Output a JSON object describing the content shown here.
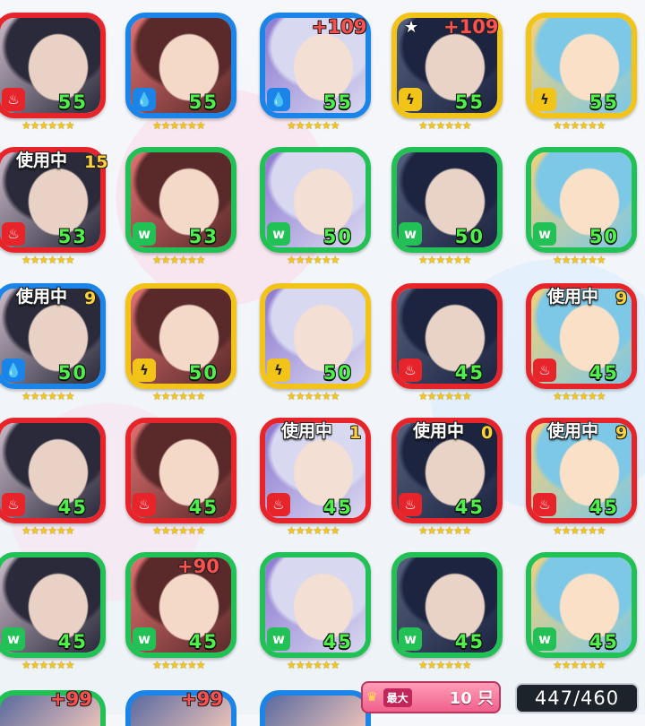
{
  "cards": [
    {
      "attr": "fire",
      "level": "55",
      "plus": "",
      "inuse": "",
      "partial": "",
      "star": false
    },
    {
      "attr": "water",
      "level": "55",
      "plus": "",
      "inuse": "",
      "partial": "",
      "star": false
    },
    {
      "attr": "water",
      "level": "55",
      "plus": "+109",
      "inuse": "",
      "partial": "",
      "star": false
    },
    {
      "attr": "thunder",
      "level": "55",
      "plus": "+109",
      "inuse": "",
      "partial": "",
      "star": true
    },
    {
      "attr": "thunder",
      "level": "55",
      "plus": "",
      "inuse": "",
      "partial": "",
      "star": false
    },
    {
      "attr": "fire",
      "level": "53",
      "plus": "",
      "inuse": "使用中",
      "partial": "15",
      "star": false
    },
    {
      "attr": "wood",
      "level": "53",
      "plus": "",
      "inuse": "",
      "partial": "",
      "star": false
    },
    {
      "attr": "wood",
      "level": "50",
      "plus": "",
      "inuse": "",
      "partial": "",
      "star": false
    },
    {
      "attr": "wood",
      "level": "50",
      "plus": "",
      "inuse": "",
      "partial": "",
      "star": false
    },
    {
      "attr": "wood",
      "level": "50",
      "plus": "",
      "inuse": "",
      "partial": "",
      "star": false
    },
    {
      "attr": "water",
      "level": "50",
      "plus": "",
      "inuse": "使用中",
      "partial": "9",
      "star": false
    },
    {
      "attr": "thunder",
      "level": "50",
      "plus": "",
      "inuse": "",
      "partial": "",
      "star": false
    },
    {
      "attr": "thunder",
      "level": "50",
      "plus": "",
      "inuse": "",
      "partial": "",
      "star": false
    },
    {
      "attr": "fire",
      "level": "45",
      "plus": "",
      "inuse": "",
      "partial": "",
      "star": false
    },
    {
      "attr": "fire",
      "level": "45",
      "plus": "",
      "inuse": "使用中",
      "partial": "9",
      "star": false
    },
    {
      "attr": "fire",
      "level": "45",
      "plus": "",
      "inuse": "",
      "partial": "",
      "star": false
    },
    {
      "attr": "fire",
      "level": "45",
      "plus": "",
      "inuse": "",
      "partial": "",
      "star": false
    },
    {
      "attr": "fire",
      "level": "45",
      "plus": "",
      "inuse": "使用中",
      "partial": "1",
      "star": false
    },
    {
      "attr": "fire",
      "level": "45",
      "plus": "",
      "inuse": "使用中",
      "partial": "0",
      "star": false
    },
    {
      "attr": "fire",
      "level": "45",
      "plus": "",
      "inuse": "使用中",
      "partial": "9",
      "star": false
    },
    {
      "attr": "wood",
      "level": "45",
      "plus": "",
      "inuse": "",
      "partial": "",
      "star": false
    },
    {
      "attr": "wood",
      "level": "45",
      "plus": "+90",
      "inuse": "",
      "partial": "",
      "star": false
    },
    {
      "attr": "wood",
      "level": "45",
      "plus": "",
      "inuse": "",
      "partial": "",
      "star": false
    },
    {
      "attr": "wood",
      "level": "45",
      "plus": "",
      "inuse": "",
      "partial": "",
      "star": false
    },
    {
      "attr": "wood",
      "level": "45",
      "plus": "",
      "inuse": "",
      "partial": "",
      "star": false
    }
  ],
  "bottom_row": [
    {
      "attr": "wood",
      "plus": "+99"
    },
    {
      "attr": "water",
      "plus": "+99"
    },
    {
      "attr": "water",
      "plus": ""
    }
  ],
  "stars_text": "★★★★★★",
  "max_badge": {
    "label": "最大",
    "value": "10 只"
  },
  "count": "447/460",
  "colors": {
    "fire": "#e8242b",
    "water": "#1a84e8",
    "thunder": "#f2c418",
    "wood": "#22c155",
    "level": "#4ef04a",
    "plus": "#ff4f4f"
  },
  "attr_icons": {
    "fire": "flame-icon",
    "water": "drop-icon",
    "thunder": "bolt-icon",
    "wood": "leaf-icon"
  }
}
